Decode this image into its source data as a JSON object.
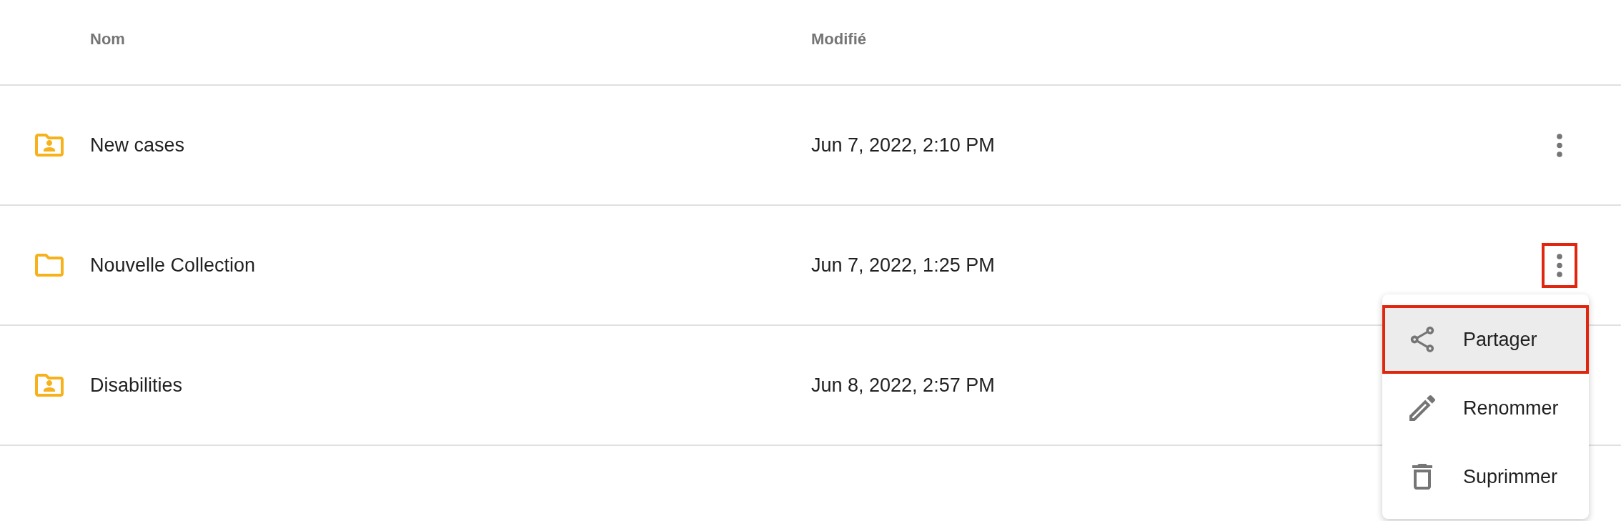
{
  "table": {
    "columns": [
      {
        "label": "Nom"
      },
      {
        "label": "Modifié"
      }
    ],
    "rows": [
      {
        "kind": "shared-folder",
        "name": "New cases",
        "modified": "Jun 7, 2022, 2:10 PM",
        "menu_button": {
          "highlighted": false
        }
      },
      {
        "kind": "folder",
        "name": "Nouvelle Collection",
        "modified": "Jun 7, 2022, 1:25 PM",
        "menu_button": {
          "highlighted": true
        }
      },
      {
        "kind": "shared-folder",
        "name": "Disabilities",
        "modified": "Jun 8, 2022, 2:57 PM"
      }
    ]
  },
  "context_menu": {
    "items": [
      {
        "kind": "share",
        "label": "Partager",
        "selected": true,
        "highlighted": true
      },
      {
        "kind": "rename",
        "label": "Renommer",
        "selected": false,
        "highlighted": false
      },
      {
        "kind": "delete",
        "label": "Suprimmer",
        "selected": false,
        "highlighted": false
      }
    ]
  }
}
